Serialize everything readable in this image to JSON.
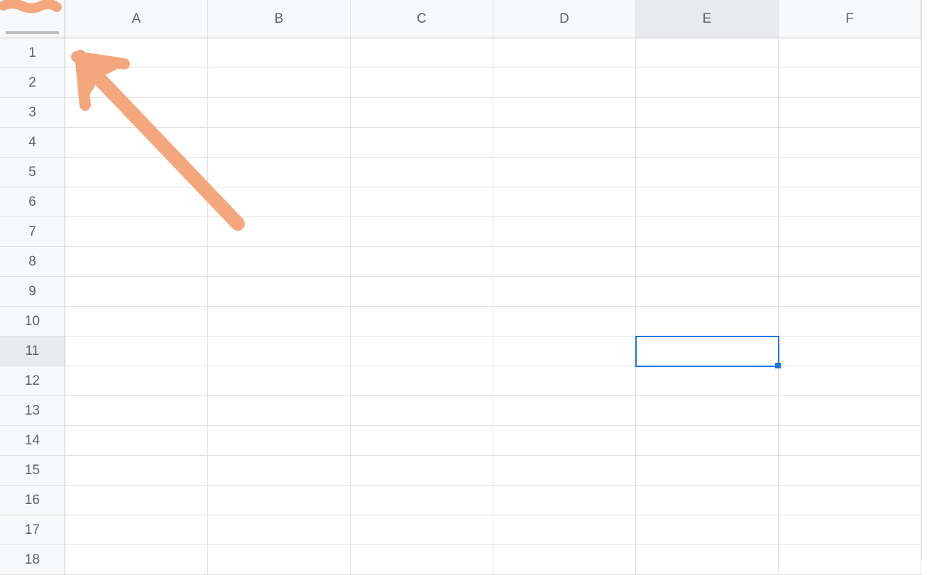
{
  "spreadsheet": {
    "columns": [
      "A",
      "B",
      "C",
      "D",
      "E",
      "F"
    ],
    "rows": [
      "1",
      "2",
      "3",
      "4",
      "5",
      "6",
      "7",
      "8",
      "9",
      "10",
      "11",
      "12",
      "13",
      "14",
      "15",
      "16",
      "17",
      "18"
    ],
    "selected_cell": {
      "col": "E",
      "row": "11",
      "col_index": 4,
      "row_index": 10
    },
    "highlighted_column": "E",
    "highlighted_row": "11"
  },
  "annotation": {
    "type": "arrow",
    "color": "#f4a77c",
    "points_to": "top-left-corner"
  }
}
